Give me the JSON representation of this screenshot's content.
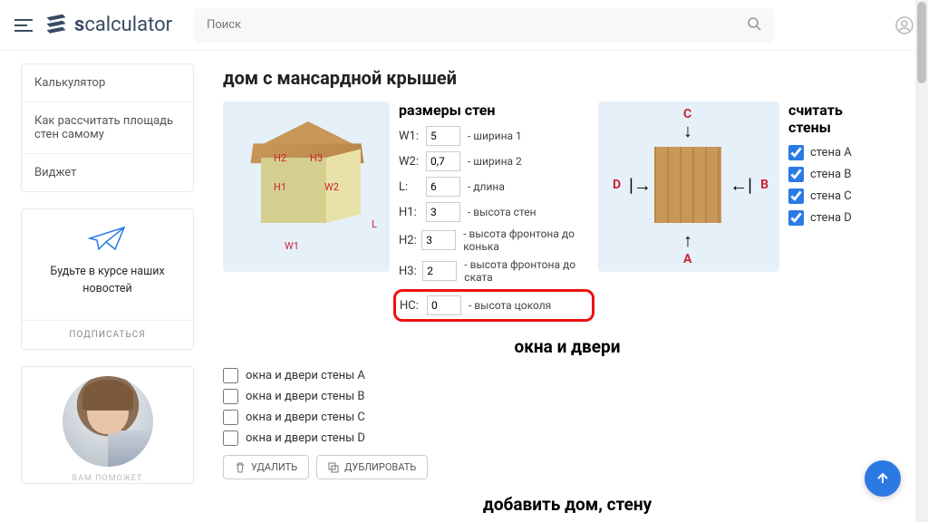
{
  "header": {
    "search_placeholder": "Поиск",
    "logo_prefix": "s",
    "logo_rest": "calculator"
  },
  "sidebar": {
    "items": [
      {
        "label": "Калькулятор"
      },
      {
        "label": "Как рассчитать площадь стен самому"
      },
      {
        "label": "Виджет"
      }
    ],
    "news_text": "Будьте в курсе наших новостей",
    "subscribe": "ПОДПИСАТЬСЯ",
    "help_tag": "ВАМ ПОМОЖЕТ"
  },
  "main": {
    "title": "дом с мансардной крышей",
    "dims_title": "размеры стен",
    "rows": [
      {
        "k": "W1:",
        "v": "5",
        "d": "- ширина 1"
      },
      {
        "k": "W2:",
        "v": "0,7",
        "d": "- ширина 2"
      },
      {
        "k": "L:",
        "v": "6",
        "d": "- длина"
      },
      {
        "k": "H1:",
        "v": "3",
        "d": "- высота стен"
      },
      {
        "k": "H2:",
        "v": "3",
        "d": "- высота фронтона до конька"
      },
      {
        "k": "H3:",
        "v": "2",
        "d": "- высота фронтона до ската"
      },
      {
        "k": "HC:",
        "v": "0",
        "d": "- высота цоколя"
      }
    ],
    "walls_title": "считать стены",
    "walls": [
      {
        "label": "стена A"
      },
      {
        "label": "стена B"
      },
      {
        "label": "стена C"
      },
      {
        "label": "стена D"
      }
    ],
    "wd_title": "окна и двери",
    "wd_opts": [
      {
        "label": "окна и двери стены A"
      },
      {
        "label": "окна и двери стены B"
      },
      {
        "label": "окна и двери стены C"
      },
      {
        "label": "окна и двери стены D"
      }
    ],
    "delete": "УДАЛИТЬ",
    "duplicate": "ДУБЛИРОВАТЬ",
    "add_title": "добавить дом, стену",
    "dia": {
      "A": "A",
      "B": "B",
      "C": "C",
      "D": "D"
    },
    "hlabels": {
      "W1": "W1",
      "W2": "W2",
      "L": "L",
      "H1": "H1",
      "H2": "H2",
      "H3": "H3"
    }
  }
}
